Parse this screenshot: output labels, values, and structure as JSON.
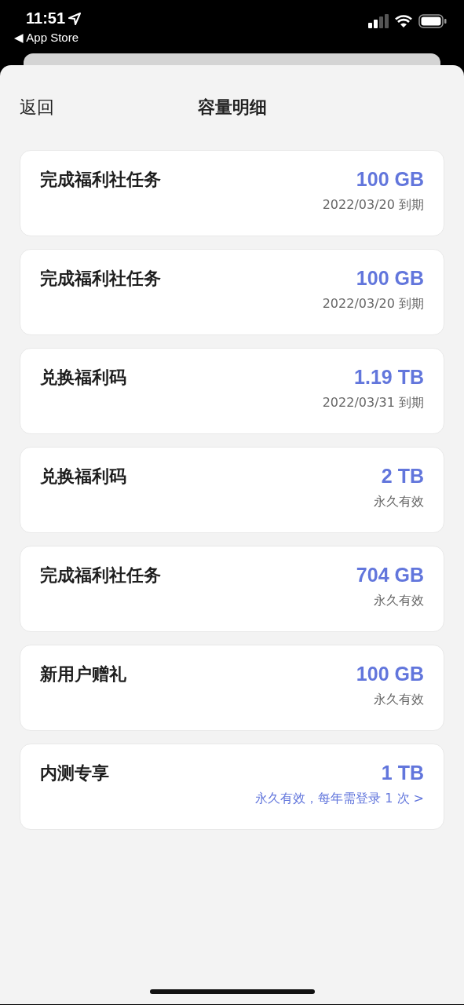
{
  "status_bar": {
    "time": "11:51",
    "back_app": "◀ App Store"
  },
  "header": {
    "back": "返回",
    "title": "容量明细"
  },
  "items": [
    {
      "title": "完成福利社任务",
      "amount": "100 GB",
      "note": "2022/03/20 到期",
      "kind": "plain"
    },
    {
      "title": "完成福利社任务",
      "amount": "100 GB",
      "note": "2022/03/20 到期",
      "kind": "plain"
    },
    {
      "title": "兑换福利码",
      "amount": "1.19 TB",
      "note": "2022/03/31 到期",
      "kind": "plain"
    },
    {
      "title": "兑换福利码",
      "amount": "2 TB",
      "note": "永久有效",
      "kind": "plain"
    },
    {
      "title": "完成福利社任务",
      "amount": "704 GB",
      "note": "永久有效",
      "kind": "plain"
    },
    {
      "title": "新用户赠礼",
      "amount": "100 GB",
      "note": "永久有效",
      "kind": "plain"
    },
    {
      "title": "内测专享",
      "amount": "1 TB",
      "note": "永久有效，每年需登录 1 次 >",
      "kind": "link"
    }
  ]
}
